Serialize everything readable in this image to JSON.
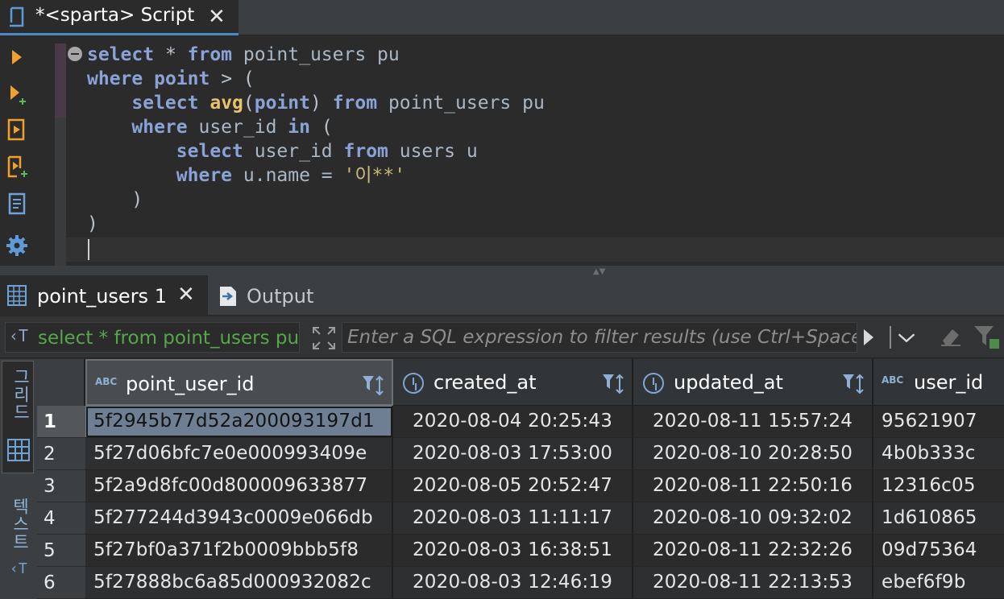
{
  "editor_tab": {
    "title": "*<sparta> Script",
    "close_glyph": "✕"
  },
  "toolbar": {
    "items": [
      "execute-statement-icon",
      "execute-statement-new-tab-icon",
      "execute-script-icon",
      "execute-script-new-tab-icon",
      "explain-plan-icon",
      "settings-gear-icon"
    ],
    "accent_color": "#f0a030"
  },
  "editor": {
    "lines": [
      [
        {
          "t": "select",
          "c": "kw"
        },
        {
          "t": " * ",
          "c": "op"
        },
        {
          "t": "from",
          "c": "kw"
        },
        {
          "t": " point_users pu",
          "c": ""
        }
      ],
      [
        {
          "t": "where",
          "c": "kw"
        },
        {
          "t": " ",
          "c": ""
        },
        {
          "t": "point",
          "c": "kw"
        },
        {
          "t": " > (",
          "c": "op"
        }
      ],
      [
        {
          "t": "    ",
          "c": ""
        },
        {
          "t": "select",
          "c": "kw"
        },
        {
          "t": " ",
          "c": ""
        },
        {
          "t": "avg",
          "c": "fn"
        },
        {
          "t": "(",
          "c": "op"
        },
        {
          "t": "point",
          "c": "kw"
        },
        {
          "t": ") ",
          "c": "op"
        },
        {
          "t": "from",
          "c": "kw"
        },
        {
          "t": " point_users pu",
          "c": ""
        }
      ],
      [
        {
          "t": "    ",
          "c": ""
        },
        {
          "t": "where",
          "c": "kw"
        },
        {
          "t": " user_id ",
          "c": ""
        },
        {
          "t": "in",
          "c": "kw"
        },
        {
          "t": " (",
          "c": "op"
        }
      ],
      [
        {
          "t": "        ",
          "c": ""
        },
        {
          "t": "select",
          "c": "kw"
        },
        {
          "t": " user_id ",
          "c": ""
        },
        {
          "t": "from",
          "c": "kw"
        },
        {
          "t": " users u",
          "c": ""
        }
      ],
      [
        {
          "t": "        ",
          "c": ""
        },
        {
          "t": "where",
          "c": "kw"
        },
        {
          "t": " u.name = ",
          "c": ""
        },
        {
          "t": "'이**'",
          "c": "str"
        }
      ],
      [
        {
          "t": "    )",
          "c": "op"
        }
      ],
      [
        {
          "t": ")",
          "c": "op"
        }
      ],
      [
        {
          "t": "",
          "c": ""
        }
      ]
    ]
  },
  "results_tabs": {
    "grid_tab": {
      "label": "point_users 1",
      "close_glyph": "✕"
    },
    "output_tab": {
      "label": "Output"
    }
  },
  "filter": {
    "query_preview": "select * from point_users pu",
    "placeholder": "Enter a SQL expression to filter results (use Ctrl+Space)"
  },
  "side_tabs": {
    "grid_label": "그리드",
    "text_label": "텍스트"
  },
  "grid": {
    "columns": [
      {
        "name": "point_user_id",
        "type_icon": "ABC"
      },
      {
        "name": "created_at",
        "type_icon": "clock-icon"
      },
      {
        "name": "updated_at",
        "type_icon": "clock-icon"
      },
      {
        "name": "user_id",
        "type_icon": "ABC"
      }
    ],
    "rows": [
      {
        "n": "1",
        "cells": [
          "5f2945b77d52a200093197d1",
          "2020-08-04 20:25:43",
          "2020-08-11 15:57:24",
          "95621907"
        ]
      },
      {
        "n": "2",
        "cells": [
          "5f27d06bfc7e0e000993409e",
          "2020-08-03 17:53:00",
          "2020-08-10 20:28:50",
          "4b0b333c"
        ]
      },
      {
        "n": "3",
        "cells": [
          "5f2a9d8fc00d800009633877",
          "2020-08-05 20:52:47",
          "2020-08-11 22:50:16",
          "12316c05"
        ]
      },
      {
        "n": "4",
        "cells": [
          "5f277244d3943c0009e066db",
          "2020-08-03 11:11:17",
          "2020-08-10 09:32:02",
          "1d610865"
        ]
      },
      {
        "n": "5",
        "cells": [
          "5f27bf0a371f2b0009bbb5f8",
          "2020-08-03 16:38:51",
          "2020-08-11 22:32:26",
          "09d75364"
        ]
      },
      {
        "n": "6",
        "cells": [
          "5f27888bc6a85d000932082c",
          "2020-08-03 12:46:19",
          "2020-08-11 22:13:53",
          "ebef6f9b"
        ]
      }
    ],
    "selected_row": 1
  }
}
